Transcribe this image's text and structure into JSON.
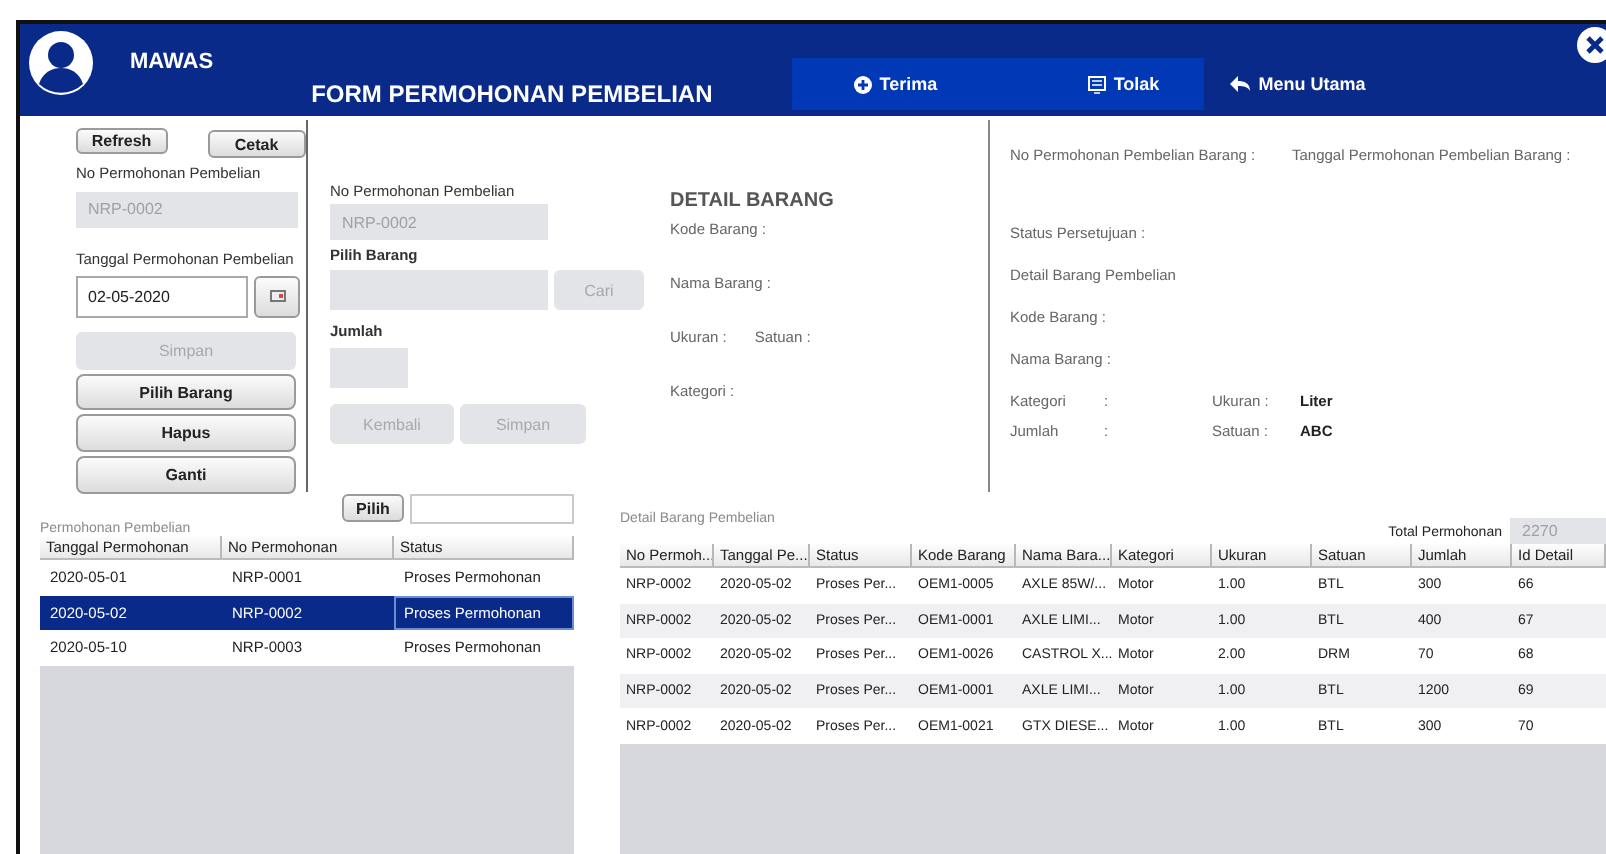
{
  "header": {
    "user_name": "MAWAS",
    "title": "FORM PERMOHONAN PEMBELIAN",
    "actions": [
      {
        "label": "Terima",
        "kind": "accept"
      },
      {
        "label": "Tolak",
        "kind": "reject"
      },
      {
        "label": "Menu Utama",
        "kind": "back"
      }
    ]
  },
  "left_panel": {
    "top_buttons": [
      {
        "label": "Refresh"
      },
      {
        "label": "Cetak"
      }
    ],
    "no_permohonan": {
      "label": "No Permohonan Pembelian",
      "value": "NRP-0002",
      "disabled": true
    },
    "tanggal": {
      "label": "Tanggal Permohonan Pembelian",
      "value": "02-05-2020"
    },
    "buttons": [
      {
        "label": "Simpan",
        "disabled": true
      },
      {
        "label": "Pilih Barang",
        "disabled": false
      },
      {
        "label": "Hapus",
        "disabled": false
      },
      {
        "label": "Ganti",
        "disabled": false
      }
    ]
  },
  "middle_panel": {
    "no_permohonan": {
      "label": "No Permohonan Pembelian",
      "value": "NRP-0002",
      "disabled": true
    },
    "pilih_barang": {
      "label": "Pilih Barang",
      "button": {
        "label": "Cari",
        "disabled": true
      }
    },
    "jumlah": {
      "label": "Jumlah"
    },
    "buttons": [
      {
        "label": "Kembali",
        "disabled": true
      },
      {
        "label": "Simpan",
        "disabled": true
      }
    ],
    "detail": {
      "title": "DETAIL BARANG",
      "lines": [
        [
          "Kode Barang  :"
        ],
        [
          "Nama Barang :"
        ],
        [
          "Ukuran  :",
          "Satuan  :"
        ],
        [
          "Kategori :"
        ]
      ]
    }
  },
  "right_panel": {
    "request_labels": [
      "No Permohonan Pembelian Barang :",
      "Tanggal Permohonan Pembelian Barang :"
    ],
    "labels": [
      "Status Persetujuan :",
      "Detail Barang Pembelian",
      "Kode Barang   :",
      "Nama Barang :"
    ],
    "attributes": [
      {
        "label": "Kategori",
        "separator": ":",
        "sub_label": "Ukuran  :",
        "sub_value": "Liter"
      },
      {
        "label": "Jumlah",
        "separator": ":",
        "sub_label": "Satuan  :",
        "sub_value": "ABC"
      }
    ]
  },
  "search": {
    "button": "Pilih"
  },
  "requests_table": {
    "caption": "Permohonan Pembelian",
    "columns": [
      "Tanggal Permohonan",
      "No Permohonan",
      "Status"
    ],
    "rows": [
      {
        "cells": [
          "2020-05-01",
          "NRP-0001",
          "Proses Permohonan"
        ],
        "selected": false
      },
      {
        "cells": [
          "2020-05-02",
          "NRP-0002",
          "Proses Permohonan"
        ],
        "selected": true
      },
      {
        "cells": [
          "2020-05-10",
          "NRP-0003",
          "Proses Permohonan"
        ],
        "selected": false
      }
    ]
  },
  "detail_table": {
    "caption": "Detail Barang Pembelian",
    "total_label": "Total Permohonan",
    "total_value": "2270",
    "columns": [
      "No Permoh...",
      "Tanggal Pe...",
      "Status",
      "Kode Barang",
      "Nama Bara...",
      "Kategori",
      "Ukuran",
      "Satuan",
      "Jumlah",
      "Id Detail"
    ],
    "rows": [
      {
        "cells": [
          "NRP-0002",
          "2020-05-02",
          "Proses Per...",
          "OEM1-0005",
          "AXLE 85W/...",
          "Motor",
          "1.00",
          "BTL",
          "300",
          "66"
        ],
        "selected": false
      },
      {
        "cells": [
          "NRP-0002",
          "2020-05-02",
          "Proses Per...",
          "OEM1-0001",
          "AXLE LIMI...",
          "Motor",
          "1.00",
          "BTL",
          "400",
          "67"
        ],
        "selected": false
      },
      {
        "cells": [
          "NRP-0002",
          "2020-05-02",
          "Proses Per...",
          "OEM1-0026",
          "CASTROL X...",
          "Motor",
          "2.00",
          "DRM",
          "70",
          "68"
        ],
        "selected": false
      },
      {
        "cells": [
          "NRP-0002",
          "2020-05-02",
          "Proses Per...",
          "OEM1-0001",
          "AXLE LIMI...",
          "Motor",
          "1.00",
          "BTL",
          "1200",
          "69"
        ],
        "selected": false
      },
      {
        "cells": [
          "NRP-0002",
          "2020-05-02",
          "Proses Per...",
          "OEM1-0021",
          "GTX DIESE...",
          "Motor",
          "1.00",
          "BTL",
          "300",
          "70"
        ],
        "selected": false
      }
    ]
  }
}
